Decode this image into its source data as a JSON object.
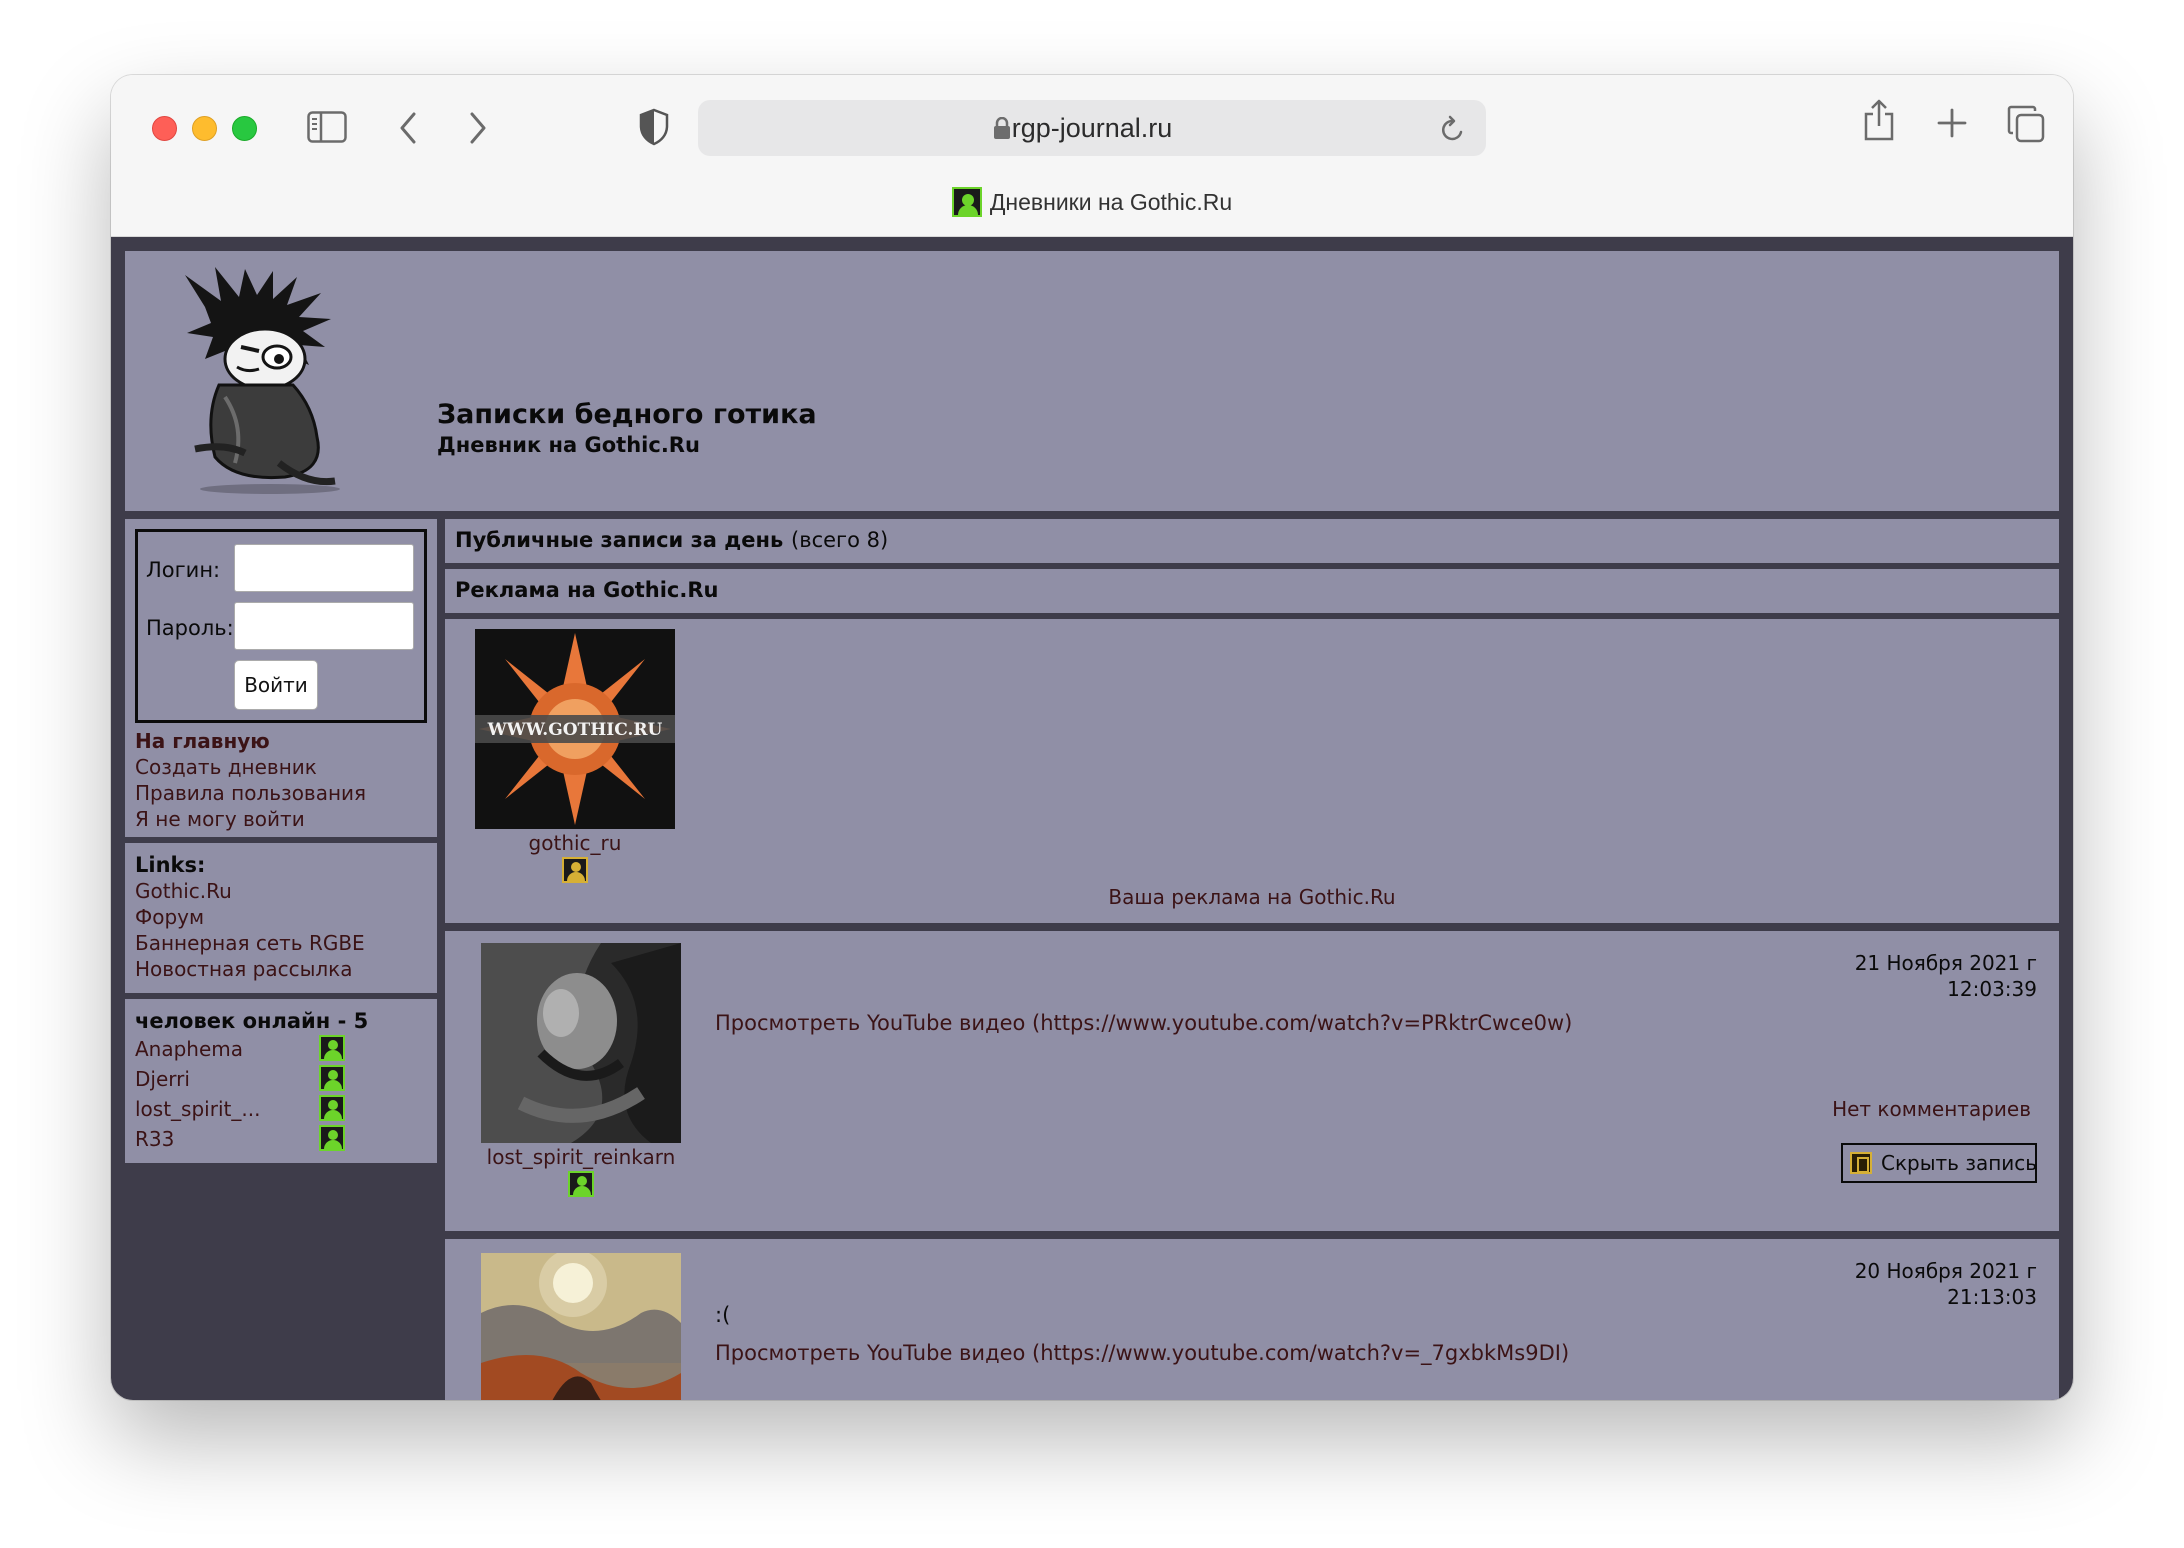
{
  "browser": {
    "url": "rgp-journal.ru",
    "tab_title": "Дневники на Gothic.Ru",
    "icons": [
      "sidebar-icon",
      "back-icon",
      "forward-icon",
      "shield-icon",
      "lock-icon",
      "reload-icon",
      "share-icon",
      "new-tab-icon",
      "tabs-overview-icon"
    ]
  },
  "header": {
    "title": "Записки бедного готика",
    "subtitle": "Дневник на Gothic.Ru"
  },
  "login": {
    "login_label": "Логин:",
    "password_label": "Пароль:",
    "submit_label": "Войти",
    "login_value": "",
    "password_value": ""
  },
  "nav": {
    "items": [
      "На главную",
      "Создать дневник",
      "Правила пользования",
      "Я не могу войти"
    ]
  },
  "links": {
    "heading": "Links:",
    "items": [
      "Gothic.Ru",
      "Форум",
      "Баннерная сеть RGBE",
      "Новостная рассылка"
    ]
  },
  "online": {
    "heading": "человек онлайн - 5",
    "users": [
      "Anaphema",
      "Djerri",
      "lost_spirit_...",
      "R33"
    ]
  },
  "feed": {
    "public_heading": "Публичные записи за день",
    "public_count": "(всего 8)",
    "ad_heading": "Реклама на Gothic.Ru"
  },
  "ad": {
    "banner_text": "WWW.GOTHIC.RU",
    "author": "gothic_ru",
    "link": "Ваша реклама на Gothic.Ru"
  },
  "posts": [
    {
      "author": "lost_spirit_reinkarn",
      "date": "21 Ноября 2021 г",
      "time": "12:03:39",
      "text": "Просмотреть YouTube видео (https://www.youtube.com/watch?v=PRktrCwce0w)",
      "comments": "Нет комментариев",
      "hide_label": "Скрыть запись"
    },
    {
      "date": "20 Ноября 2021 г",
      "time": "21:13:03",
      "intro": ":(",
      "text": "Просмотреть YouTube видео (https://www.youtube.com/watch?v=_7gxbkMs9DI)"
    }
  ],
  "colors": {
    "page_bg": "#3e3c4a",
    "panel_bg": "#908fa6",
    "link": "#3b1316",
    "online_icon": "#6cd42a"
  }
}
